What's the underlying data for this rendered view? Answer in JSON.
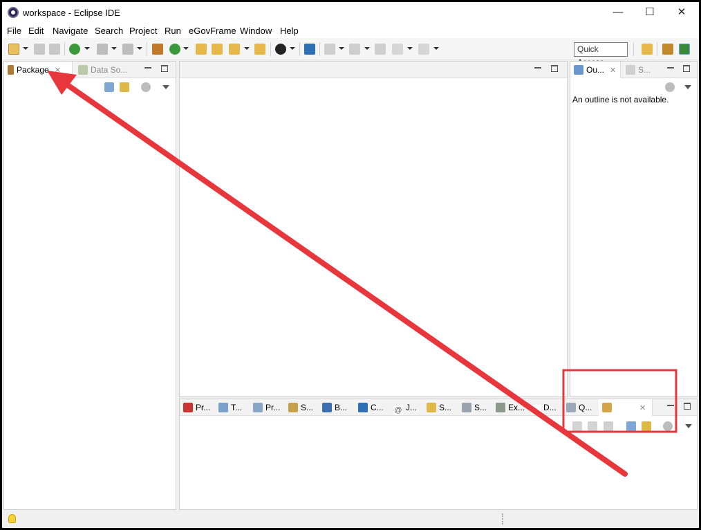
{
  "window": {
    "title": "workspace - Eclipse IDE",
    "controls": {
      "minimize": "—",
      "maximize": "☐",
      "close": "✕"
    }
  },
  "menubar": [
    "File",
    "Edit",
    "Navigate",
    "Search",
    "Project",
    "Run",
    "eGovFrame",
    "Window",
    "Help"
  ],
  "toolbar": {
    "quick_access": "Quick Access"
  },
  "left_panel": {
    "tabs": [
      {
        "label": "Package",
        "icon": "package-explorer-icon",
        "active": true
      },
      {
        "label": "Data So...",
        "icon": "data-source-icon",
        "active": false
      }
    ]
  },
  "right_panel": {
    "tabs": [
      {
        "label": "Ou...",
        "icon": "outline-icon",
        "active": true
      },
      {
        "label": "S...",
        "icon": "structure-icon",
        "active": false
      }
    ],
    "message": "An outline is not available."
  },
  "bottom_panel": {
    "tabs": [
      {
        "label": "Pr...",
        "icon": "problems-icon"
      },
      {
        "label": "T...",
        "icon": "tasks-icon"
      },
      {
        "label": "Pr...",
        "icon": "properties-icon"
      },
      {
        "label": "S...",
        "icon": "servers-icon"
      },
      {
        "label": "B...",
        "icon": "bookmarks-icon"
      },
      {
        "label": "C...",
        "icon": "console-icon"
      },
      {
        "label": "J...",
        "icon": "javadoc-icon"
      },
      {
        "label": "S...",
        "icon": "snippets-icon"
      },
      {
        "label": "S...",
        "icon": "search-icon"
      },
      {
        "label": "Ex...",
        "icon": "execution-icon"
      },
      {
        "label": "D...",
        "icon": "declaration-icon"
      },
      {
        "label": "Q...",
        "icon": "query-icon"
      }
    ],
    "active_tab_icon": "hierarchy-icon"
  },
  "colors": {
    "annotation_red": "#e8363d",
    "accent_blue": "#2f6fb5"
  }
}
